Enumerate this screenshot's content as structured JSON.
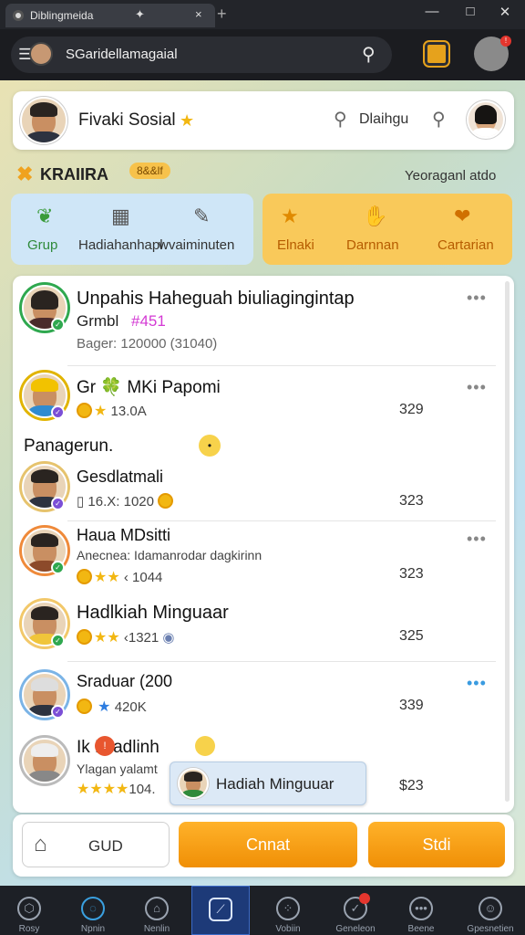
{
  "window": {
    "tab_title": "Diblingmeida",
    "pin_glyph": "✦",
    "close_glyph": "×",
    "newtab_glyph": "+",
    "minimize_glyph": "—",
    "maximize_glyph": "□",
    "winclose_glyph": "✕"
  },
  "address": {
    "menu_glyph": "☰",
    "url": "SGaridellamagaial",
    "search_glyph": "⚲",
    "profile_badge": "!"
  },
  "header": {
    "name": "Fivaki Sosial",
    "search_label": "Dlaihgu"
  },
  "section": {
    "title": "KRAIIRA",
    "tag": "8&&lf",
    "right_text": "Yeoraganl atdo"
  },
  "categories": {
    "blue": [
      {
        "label": "Grup",
        "icon": "leaf-icon"
      },
      {
        "label": "Hadiahanhapl",
        "icon": "grid-icon"
      },
      {
        "label": "wvaiminuten",
        "icon": "chat-icon"
      }
    ],
    "orange": [
      {
        "label": "Elnaki",
        "icon": "star-icon"
      },
      {
        "label": "Darnnan",
        "icon": "hand-icon"
      },
      {
        "label": "Cartarian",
        "icon": "heart-icon"
      }
    ]
  },
  "list": {
    "items": [
      {
        "title": "Unpahis Haheguah biuliagingintap",
        "sub1": "Grmbl",
        "sub1_accent": "#451",
        "sub2": "Bager: 120000 (31040)",
        "num": ""
      },
      {
        "title": "Gr 🍀  MKi Papomi",
        "sub": "13.0A",
        "num": "329"
      },
      {
        "title": "Gesdlatmali",
        "sub": "16.X: 1020",
        "num": "323"
      },
      {
        "title": "Haua MDsitti",
        "sub2": "Anecnea: Idamanrodar dagkirinn",
        "sub": "1044",
        "num": "323"
      },
      {
        "title": "Hadlkiah Minguaar",
        "sub": "1321",
        "num": "325"
      },
      {
        "title": "Sraduar (200",
        "sub": "420K",
        "num": "339"
      },
      {
        "title": "Ik  Miadlinh",
        "sub2": "Ylagan yalamt",
        "sub": "104.",
        "num": "$23"
      }
    ],
    "section_label": "Panagerun.",
    "popup_label": "Hadiah Minguuar"
  },
  "bottom": {
    "home_label": "GUD",
    "orange_btn": "Cnnat",
    "orange_btn2": "Stdi"
  },
  "nav": [
    {
      "label": "Rosy"
    },
    {
      "label": "Npnin"
    },
    {
      "label": "Nenlin"
    },
    {
      "label": ""
    },
    {
      "label": "Vobiin"
    },
    {
      "label": "Geneleon"
    },
    {
      "label": "Beene"
    },
    {
      "label": "Gpesnetien"
    }
  ],
  "colors": {
    "accent_orange": "#f5a31a",
    "accent_blue": "#cfe6f7",
    "nav_active": "#1d4b9b"
  }
}
